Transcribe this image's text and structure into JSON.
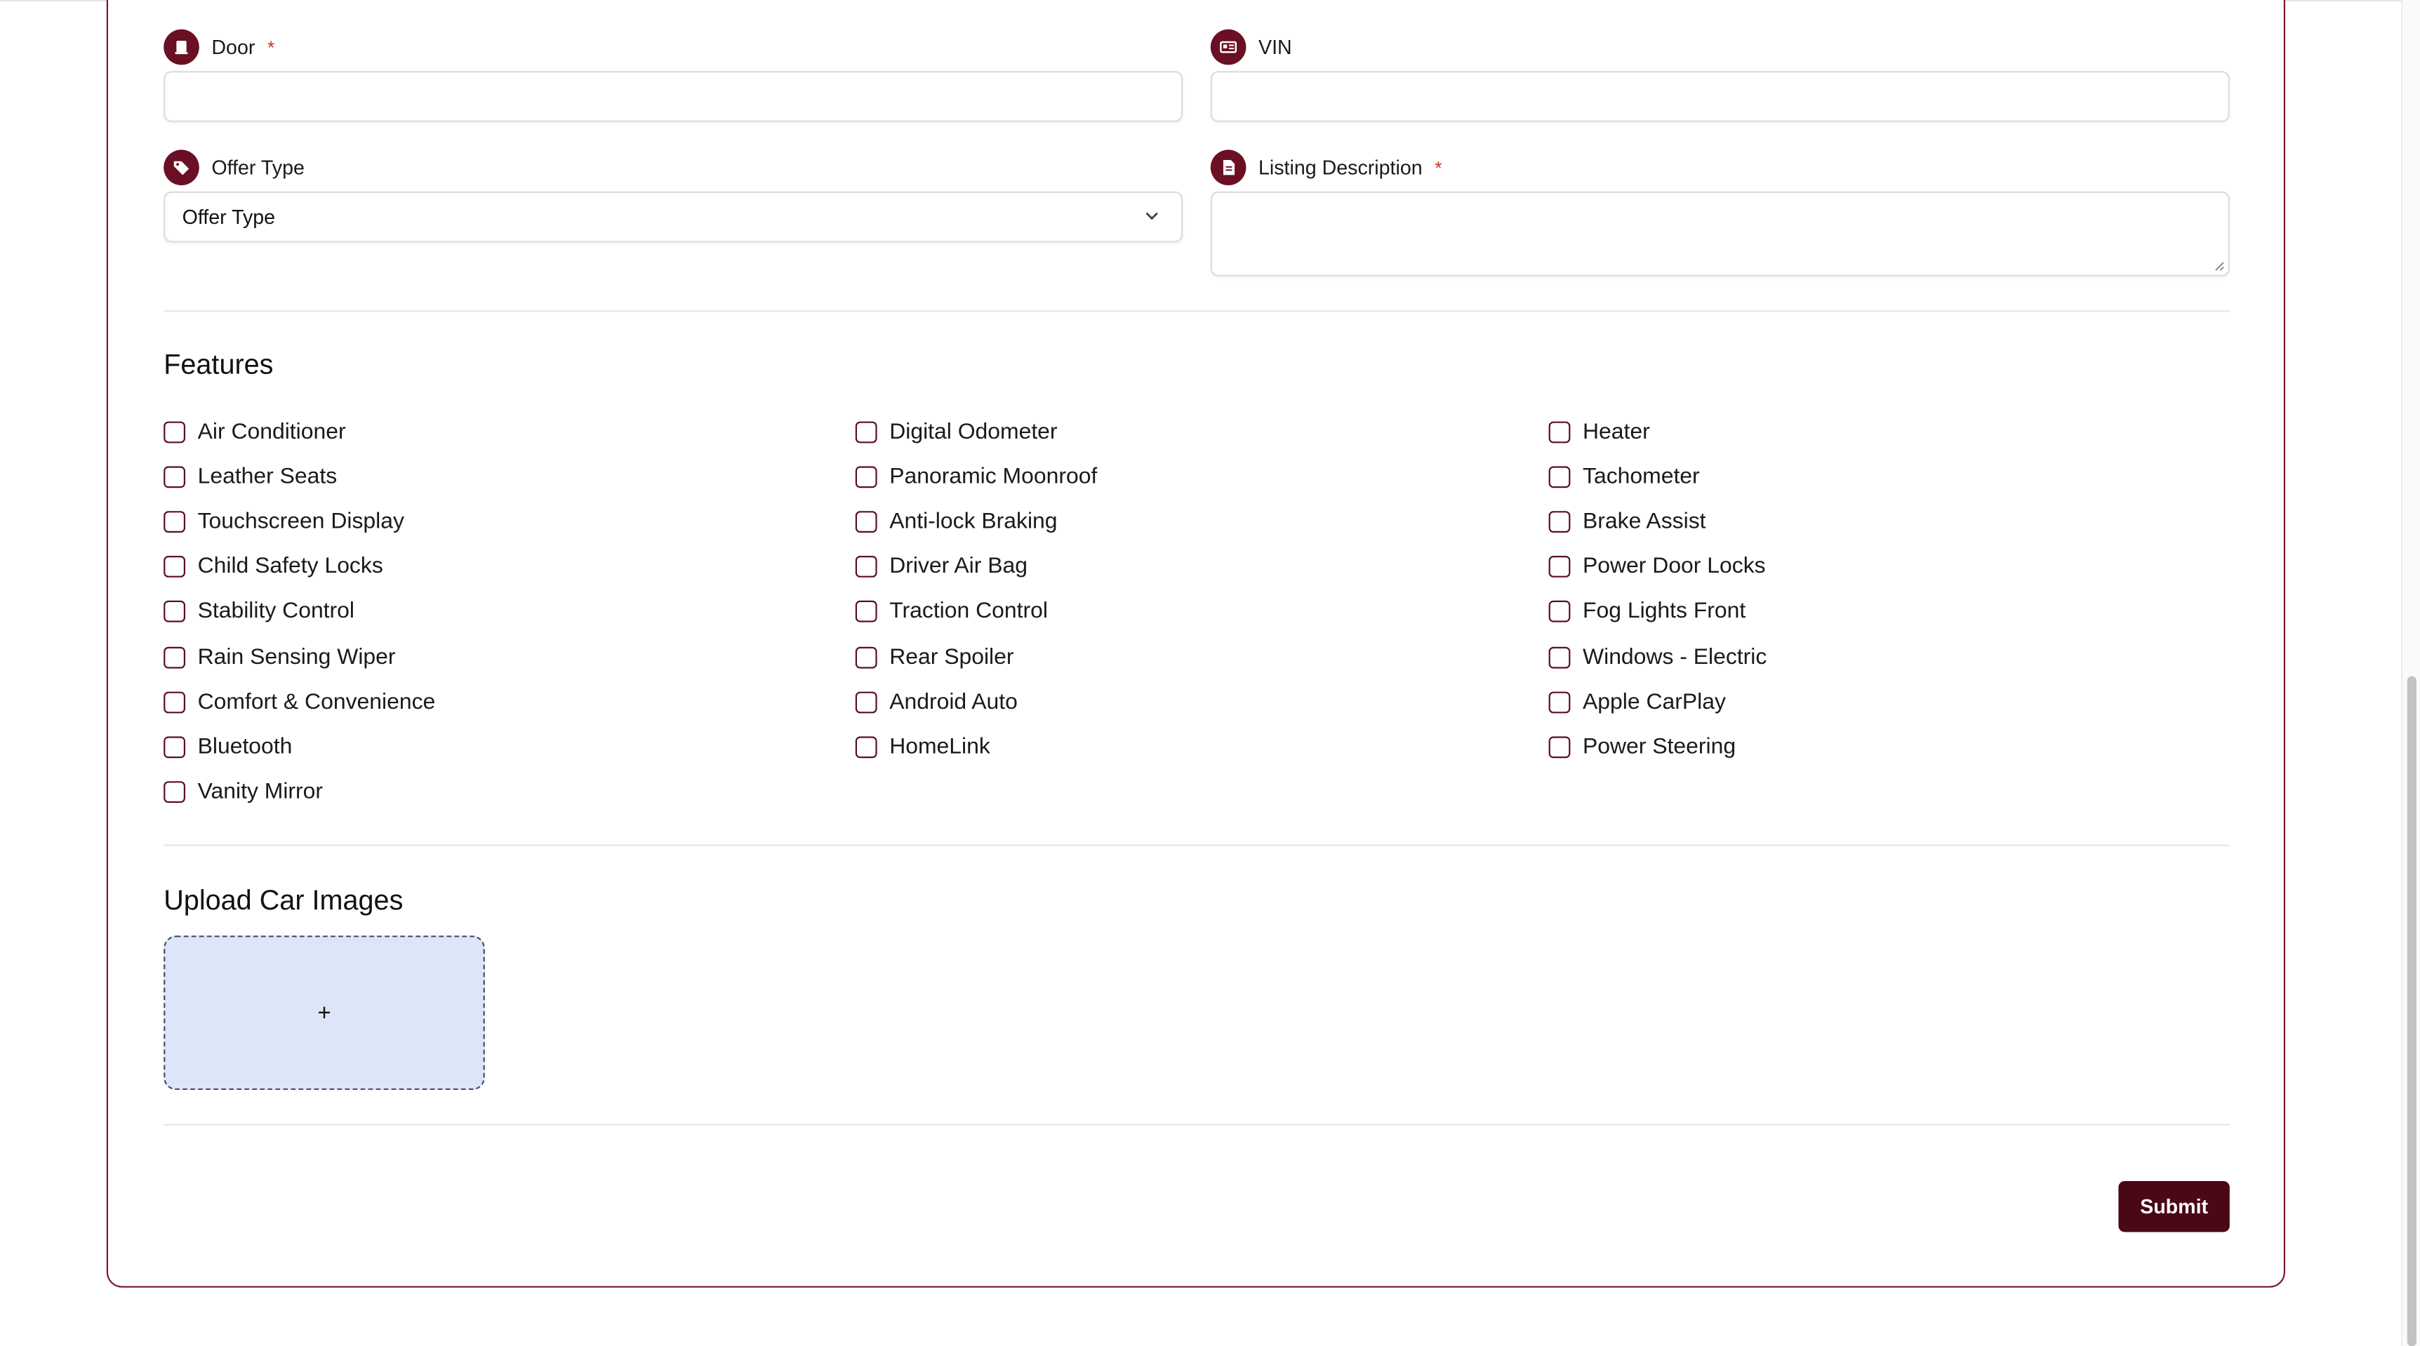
{
  "form": {
    "door": {
      "label": "Door",
      "required_mark": "*",
      "value": ""
    },
    "vin": {
      "label": "VIN",
      "value": ""
    },
    "offer_type": {
      "label": "Offer Type",
      "selected": "Offer Type"
    },
    "listing_description": {
      "label": "Listing Description",
      "required_mark": "*",
      "value": ""
    }
  },
  "features": {
    "title": "Features",
    "columns": [
      [
        "Air Conditioner",
        "Leather Seats",
        "Touchscreen Display",
        "Child Safety Locks",
        "Stability Control",
        "Rain Sensing Wiper",
        "Comfort & Convenience",
        "Bluetooth",
        "Vanity Mirror"
      ],
      [
        "Digital Odometer",
        "Panoramic Moonroof",
        "Anti-lock Braking",
        "Driver Air Bag",
        "Traction Control",
        "Rear Spoiler",
        "Android Auto",
        "HomeLink"
      ],
      [
        "Heater",
        "Tachometer",
        "Brake Assist",
        "Power Door Locks",
        "Fog Lights Front",
        "Windows - Electric",
        "Apple CarPlay",
        "Power Steering"
      ]
    ]
  },
  "upload": {
    "title": "Upload Car Images",
    "add_symbol": "+"
  },
  "submit_label": "Submit",
  "colors": {
    "accent": "#6b0f24",
    "button": "#4a0716",
    "card_border": "#7a1a2c",
    "required": "#d0342c",
    "upload_bg": "#dde6f8"
  },
  "icons": {
    "door": "door-icon",
    "vin": "id-card-icon",
    "offer_type": "tag-icon",
    "listing_description": "document-icon"
  }
}
